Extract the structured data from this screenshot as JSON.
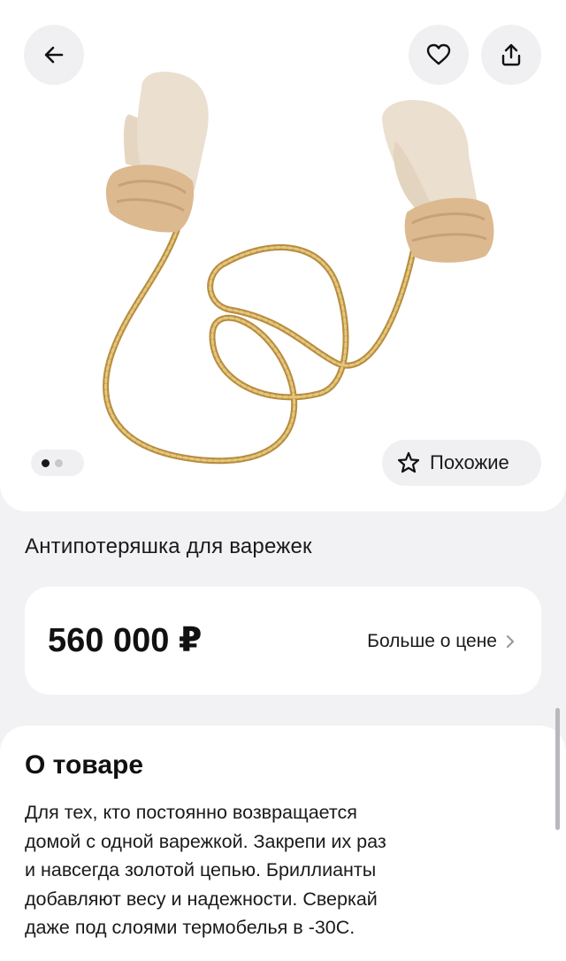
{
  "product": {
    "title": "Антипотеряшка для варежек",
    "image_alt": "product-photo-mittens-with-gold-chain"
  },
  "header": {
    "back_icon": "arrow-left-icon",
    "favorite_icon": "heart-icon",
    "share_icon": "share-icon"
  },
  "gallery": {
    "total_images": 2,
    "active_index": 0,
    "similar_label": "Похожие",
    "similar_icon": "star-icon"
  },
  "price": {
    "value": "560 000 ₽",
    "more_label": "Больше о цене"
  },
  "about": {
    "title": "О товаре",
    "lines": [
      "Для тех, кто постоянно возвращается",
      "домой с одной варежкой. Закрепи их раз",
      "и навсегда золотой цепью. Бриллианты",
      "добавляют весу и надежности. Сверкай",
      "даже под слоями термобелья в -30С."
    ]
  },
  "colors": {
    "background": "#f2f2f4",
    "card": "#ffffff",
    "button_bg": "#f0f0f2",
    "mitten": "#e9dccb",
    "fur": "#dcb98f",
    "chain": "#c9a45c"
  }
}
